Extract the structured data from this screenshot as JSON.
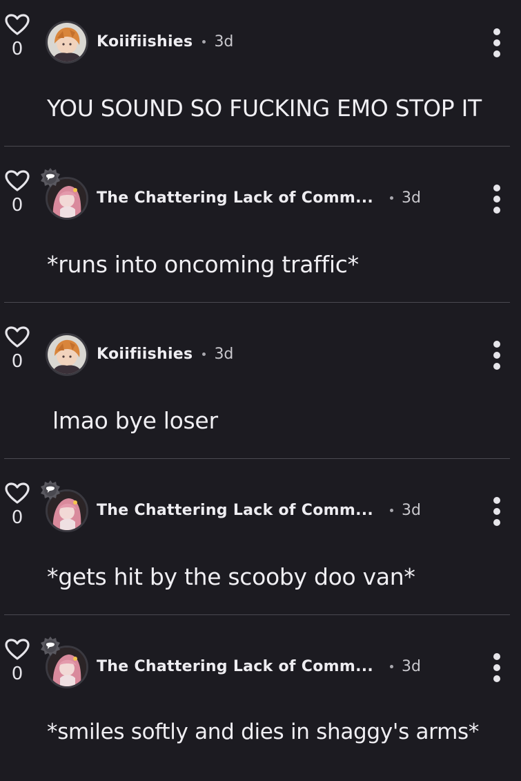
{
  "comments": [
    {
      "author": "Koiifiishies",
      "time": "3d",
      "likes": "0",
      "text": "YOU SOUND SO FUCKING EMO STOP IT",
      "avatar": "orange-hair-avatar",
      "badge": false
    },
    {
      "author": "The Chattering Lack of Comm...",
      "time": "3d",
      "likes": "0",
      "text": "*runs into oncoming traffic*",
      "avatar": "pink-hair-avatar",
      "badge": true
    },
    {
      "author": "Koiifiishies",
      "time": "3d",
      "likes": "0",
      "text": "lmao bye loser",
      "avatar": "orange-hair-avatar",
      "badge": false
    },
    {
      "author": "The Chattering Lack of Comm...",
      "time": "3d",
      "likes": "0",
      "text": "*gets hit by the scooby doo van*",
      "avatar": "pink-hair-avatar",
      "badge": true
    },
    {
      "author": "The Chattering Lack of Comm...",
      "time": "3d",
      "likes": "0",
      "text": "*smiles softly and dies in shaggy's arms*",
      "avatar": "pink-hair-avatar",
      "badge": true
    }
  ],
  "colors": {
    "background": "#1c1b21",
    "text": "#f0eff3",
    "muted": "#c9c8cd",
    "divider": "#4b4a51"
  }
}
